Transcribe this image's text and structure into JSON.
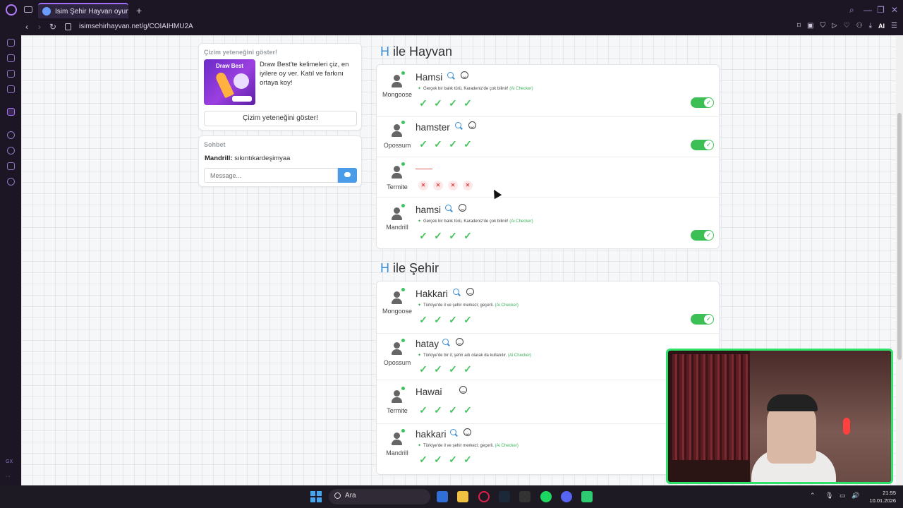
{
  "browser": {
    "tab_title": "İsim Şehir Hayvan oyunun...",
    "url": "isimsehirhayvan.net/g/COIAIHMU2A",
    "ai_label": "AI"
  },
  "left_panel": {
    "draw_card": {
      "title": "Çizim yeteneğini göster!",
      "image_label": "Draw Best",
      "text": "Draw Best'te kelimeleri çiz, en iyilere oy ver. Katıl ve farkını ortaya koy!",
      "button_label": "Çizim yeteneğini göster!"
    },
    "chat": {
      "title": "Sohbet",
      "messages": [
        {
          "user": "Mandrill:",
          "text": "sıkıntıkardeşimyaa"
        }
      ],
      "input_placeholder": "Message..."
    }
  },
  "sections": [
    {
      "letter": "H",
      "title": "ile Hayvan",
      "rows": [
        {
          "player": "Mongoose",
          "word": "Hamsi",
          "desc": "Gerçek bir balık türü, Karadeniz'de çok bilinir!",
          "ai": "(Ai Checker)",
          "marks": [
            "ok",
            "ok",
            "ok",
            "ok"
          ],
          "toggle": true
        },
        {
          "player": "Opossum",
          "word": "hamster",
          "desc": "",
          "ai": "",
          "marks": [
            "ok",
            "ok",
            "ok",
            "ok"
          ],
          "toggle": true
        },
        {
          "player": "Termite",
          "word": "",
          "desc": "",
          "ai": "",
          "marks": [
            "no",
            "no",
            "no",
            "no"
          ],
          "toggle": false
        },
        {
          "player": "Mandrill",
          "word": "hamsi",
          "desc": "Gerçek bir balık türü, Karadeniz'de çok bilinir!",
          "ai": "(Ai Checker)",
          "marks": [
            "ok",
            "ok",
            "ok",
            "ok"
          ],
          "toggle": true
        }
      ]
    },
    {
      "letter": "H",
      "title": "ile Şehir",
      "rows": [
        {
          "player": "Mongoose",
          "word": "Hakkari",
          "desc": "Türkiye'de il ve şehir merkezi; geçerli.",
          "ai": "(Ai Checker)",
          "marks": [
            "ok",
            "ok",
            "ok",
            "ok"
          ],
          "toggle": true
        },
        {
          "player": "Opossum",
          "word": "hatay",
          "desc": "Türkiye'de bir il; şehir adı olarak da kullanılır.",
          "ai": "(Ai Checker)",
          "marks": [
            "ok",
            "ok",
            "ok",
            "ok"
          ],
          "toggle": false
        },
        {
          "player": "Termite",
          "word": "Hawai",
          "desc": "",
          "ai": "",
          "marks": [
            "ok",
            "ok",
            "ok",
            "ok"
          ],
          "toggle": false
        },
        {
          "player": "Mandrill",
          "word": "hakkari",
          "desc": "Türkiye'de il ve şehir merkezi; geçerli.",
          "ai": "(Ai Checker)",
          "marks": [
            "ok",
            "ok",
            "ok",
            "ok"
          ],
          "toggle": false
        }
      ]
    }
  ],
  "taskbar": {
    "search_label": "Ara",
    "time": "21:55",
    "date": "10.01.2026"
  },
  "colors": {
    "accent_blue": "#3b8fd6",
    "ok_green": "#46c35c",
    "fail_red": "#e04848",
    "toggle_green": "#3cbf55",
    "browser_purple": "#a070ff"
  }
}
